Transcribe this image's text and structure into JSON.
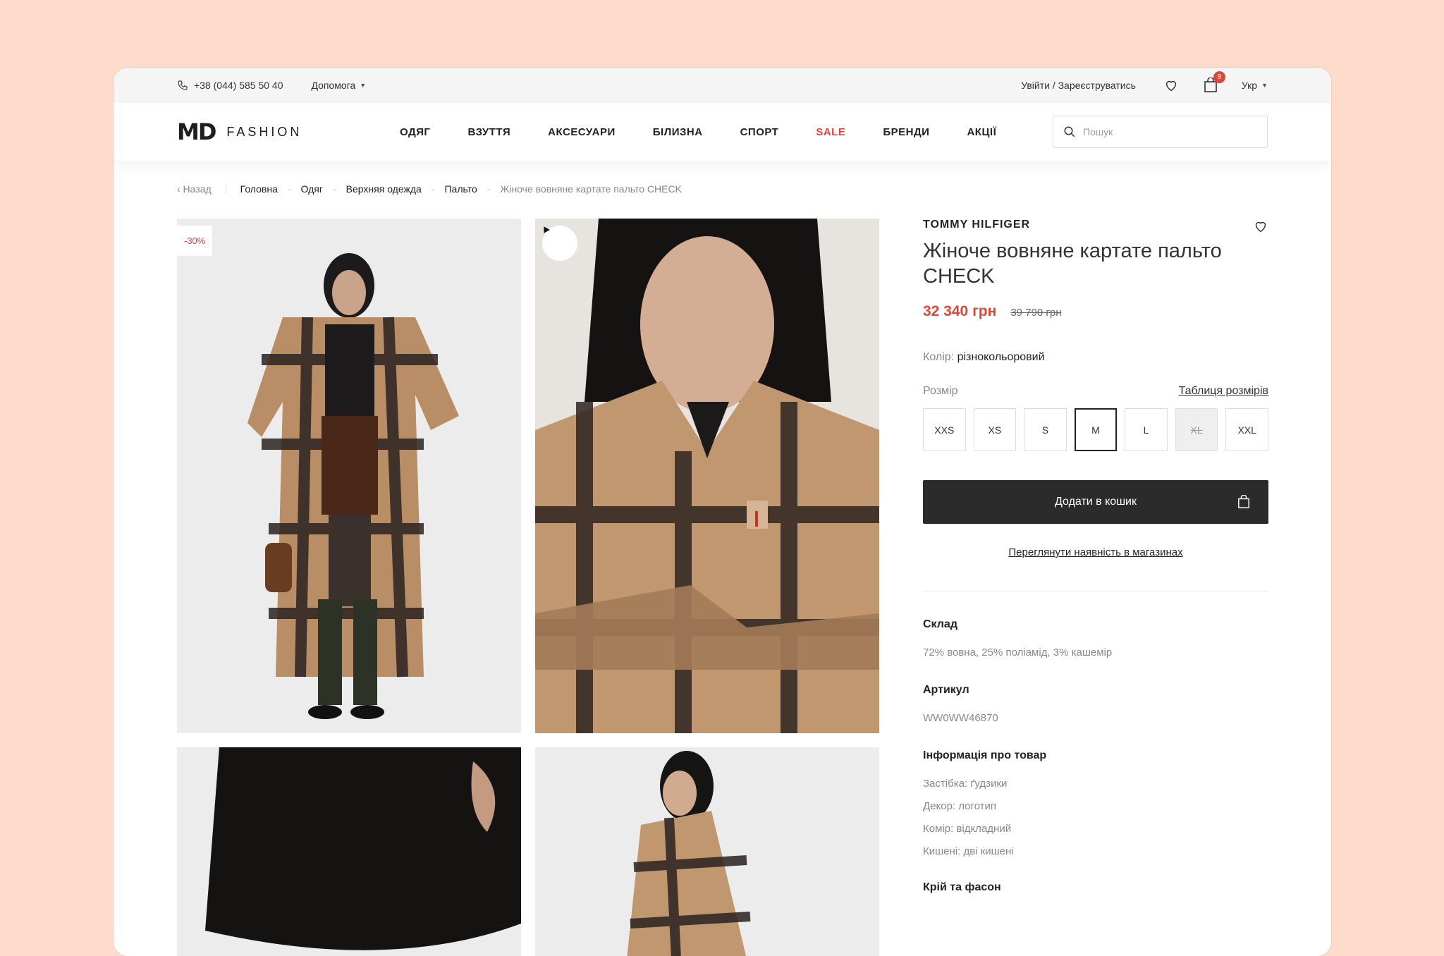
{
  "topbar": {
    "phone": "+38 (044) 585 50 40",
    "help": "Допомога",
    "login": "Увійти / Зареєструватись",
    "cart_count": "8",
    "lang": "Укр"
  },
  "header": {
    "logo_md": "MD",
    "logo_fashion": "FASHION",
    "nav": [
      "ОДЯГ",
      "ВЗУТТЯ",
      "АКСЕСУАРИ",
      "БІЛИЗНА",
      "СПОРТ",
      "SALE",
      "БРЕНДИ",
      "АКЦІЇ"
    ],
    "search_placeholder": "Пошук"
  },
  "breadcrumb": {
    "back": "‹ Назад",
    "items": [
      "Головна",
      "Одяг",
      "Верхняя одежда",
      "Пальто"
    ],
    "current": "Жіноче вовняне картате пальто CHECK"
  },
  "gallery": {
    "discount_badge": "-30%"
  },
  "product": {
    "brand": "TOMMY HILFIGER",
    "title": "Жіноче вовняне картате пальто CHECK",
    "price": "32 340 грн",
    "old_price": "39 790 грн",
    "color_label": "Колір:",
    "color_value": "різнокольоровий",
    "size_label": "Розмір",
    "size_table": "Таблиця розмірів",
    "sizes": [
      "XXS",
      "XS",
      "S",
      "M",
      "L",
      "XL",
      "XXL"
    ],
    "selected_size": "M",
    "unavailable_size": "XL",
    "add_to_cart": "Додати в кошик",
    "availability": "Переглянути наявність в магазинах",
    "composition_title": "Склад",
    "composition": "72% вовна, 25% поліамід, 3% кашемір",
    "sku_title": "Артикул",
    "sku": "WW0WW46870",
    "details_title": "Інформація про товар",
    "details": [
      "Застібка: ґудзики",
      "Декор: логотип",
      "Комір: відкладний",
      "Кишені: дві кишені"
    ],
    "fit_title": "Крій та фасон"
  },
  "colors": {
    "accent": "#e0453a",
    "button": "#2b2b2b",
    "background": "#fddccb"
  }
}
